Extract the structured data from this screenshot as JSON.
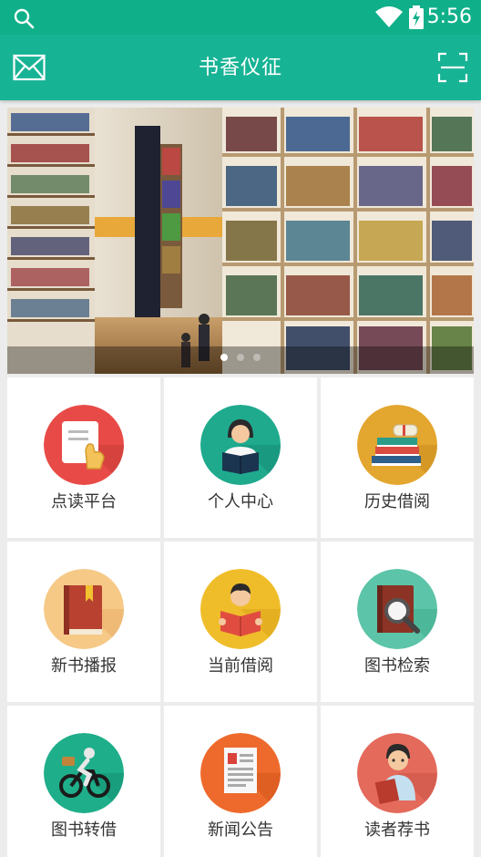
{
  "status_bar": {
    "time": "5:56"
  },
  "header": {
    "title": "书香仪征"
  },
  "banner": {
    "slides": 3,
    "active": 1
  },
  "menu": [
    {
      "label": "点读平台",
      "color": "#e84b47",
      "icon": "reading-hand-icon"
    },
    {
      "label": "个人中心",
      "color": "#1faa8e",
      "icon": "person-reading-icon"
    },
    {
      "label": "历史借阅",
      "color": "#e3a62f",
      "icon": "book-stack-icon"
    },
    {
      "label": "新书播报",
      "color": "#f6c987",
      "icon": "red-book-icon"
    },
    {
      "label": "当前借阅",
      "color": "#f0bd2a",
      "icon": "child-reading-icon"
    },
    {
      "label": "图书检索",
      "color": "#5cc4a8",
      "icon": "book-search-icon"
    },
    {
      "label": "图书转借",
      "color": "#1fae8a",
      "icon": "cyclist-icon"
    },
    {
      "label": "新闻公告",
      "color": "#ee6a2c",
      "icon": "news-document-icon"
    },
    {
      "label": "读者荐书",
      "color": "#e46a5c",
      "icon": "reader-recommend-icon"
    }
  ]
}
